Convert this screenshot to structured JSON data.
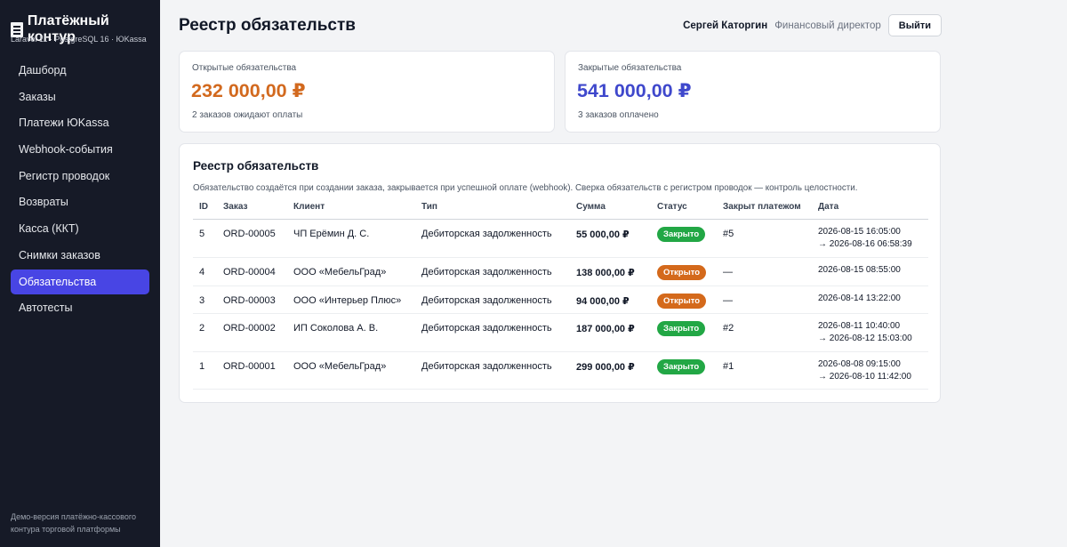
{
  "brand": {
    "title": "Платёжный контур",
    "subtitle": "Laravel 11 · PostgreSQL 16 · ЮKassa",
    "icon": "document-icon"
  },
  "nav": [
    {
      "label": "Дашборд",
      "active": false
    },
    {
      "label": "Заказы",
      "active": false
    },
    {
      "label": "Платежи ЮKassa",
      "active": false
    },
    {
      "label": "Webhook-события",
      "active": false
    },
    {
      "label": "Регистр проводок",
      "active": false
    },
    {
      "label": "Возвраты",
      "active": false
    },
    {
      "label": "Касса (ККТ)",
      "active": false
    },
    {
      "label": "Снимки заказов",
      "active": false
    },
    {
      "label": "Обязательства",
      "active": true
    },
    {
      "label": "Автотесты",
      "active": false
    }
  ],
  "sidebar_footer": "Демо-версия платёжно-кассового контура торговой платформы",
  "header": {
    "title": "Реестр обязательств",
    "user_name": "Сергей Каторгин",
    "user_role": "Финансовый директор",
    "logout_label": "Выйти"
  },
  "kpis": [
    {
      "label": "Открытые обязательства",
      "value": "232 000,00 ₽",
      "note": "2 заказов ожидают оплаты",
      "color": "#d2691e"
    },
    {
      "label": "Закрытые обязательства",
      "value": "541 000,00 ₽",
      "note": "3 заказов оплачено",
      "color": "#3f48cc"
    }
  ],
  "registry": {
    "title": "Реестр обязательств",
    "description": "Обязательство создаётся при создании заказа, закрывается при успешной оплате (webhook). Сверка обязательств с регистром проводок — контроль целостности.",
    "columns": {
      "id": "ID",
      "order": "Заказ",
      "client": "Клиент",
      "type": "Тип",
      "amount": "Сумма",
      "status": "Статус",
      "payment": "Закрыт платежом",
      "date": "Дата"
    },
    "rows": [
      {
        "id": "5",
        "order": "ORD-00005",
        "client": "ЧП Ерёмин Д. С.",
        "type": "Дебиторская задолженность",
        "amount": "55 000,00 ₽",
        "status": "Закрыто",
        "status_kind": "closed",
        "payment": "#5",
        "date_line1": "2026-08-15 16:05:00",
        "date_line2": "→ 2026-08-16 06:58:39"
      },
      {
        "id": "4",
        "order": "ORD-00004",
        "client": "ООО «МебельГрад»",
        "type": "Дебиторская задолженность",
        "amount": "138 000,00 ₽",
        "status": "Открыто",
        "status_kind": "open",
        "payment": "—",
        "date_line1": "2026-08-15 08:55:00",
        "date_line2": ""
      },
      {
        "id": "3",
        "order": "ORD-00003",
        "client": "ООО «Интерьер Плюс»",
        "type": "Дебиторская задолженность",
        "amount": "94 000,00 ₽",
        "status": "Открыто",
        "status_kind": "open",
        "payment": "—",
        "date_line1": "2026-08-14 13:22:00",
        "date_line2": ""
      },
      {
        "id": "2",
        "order": "ORD-00002",
        "client": "ИП Соколова А. В.",
        "type": "Дебиторская задолженность",
        "amount": "187 000,00 ₽",
        "status": "Закрыто",
        "status_kind": "closed",
        "payment": "#2",
        "date_line1": "2026-08-11 10:40:00",
        "date_line2": "→ 2026-08-12 15:03:00"
      },
      {
        "id": "1",
        "order": "ORD-00001",
        "client": "ООО «МебельГрад»",
        "type": "Дебиторская задолженность",
        "amount": "299 000,00 ₽",
        "status": "Закрыто",
        "status_kind": "closed",
        "payment": "#1",
        "date_line1": "2026-08-08 09:15:00",
        "date_line2": "→ 2026-08-10 11:42:00"
      }
    ]
  },
  "colors": {
    "sidebar_bg": "#161a27",
    "active_nav": "#4845e4",
    "status_closed": "#22a745",
    "status_open": "#d4691b"
  }
}
